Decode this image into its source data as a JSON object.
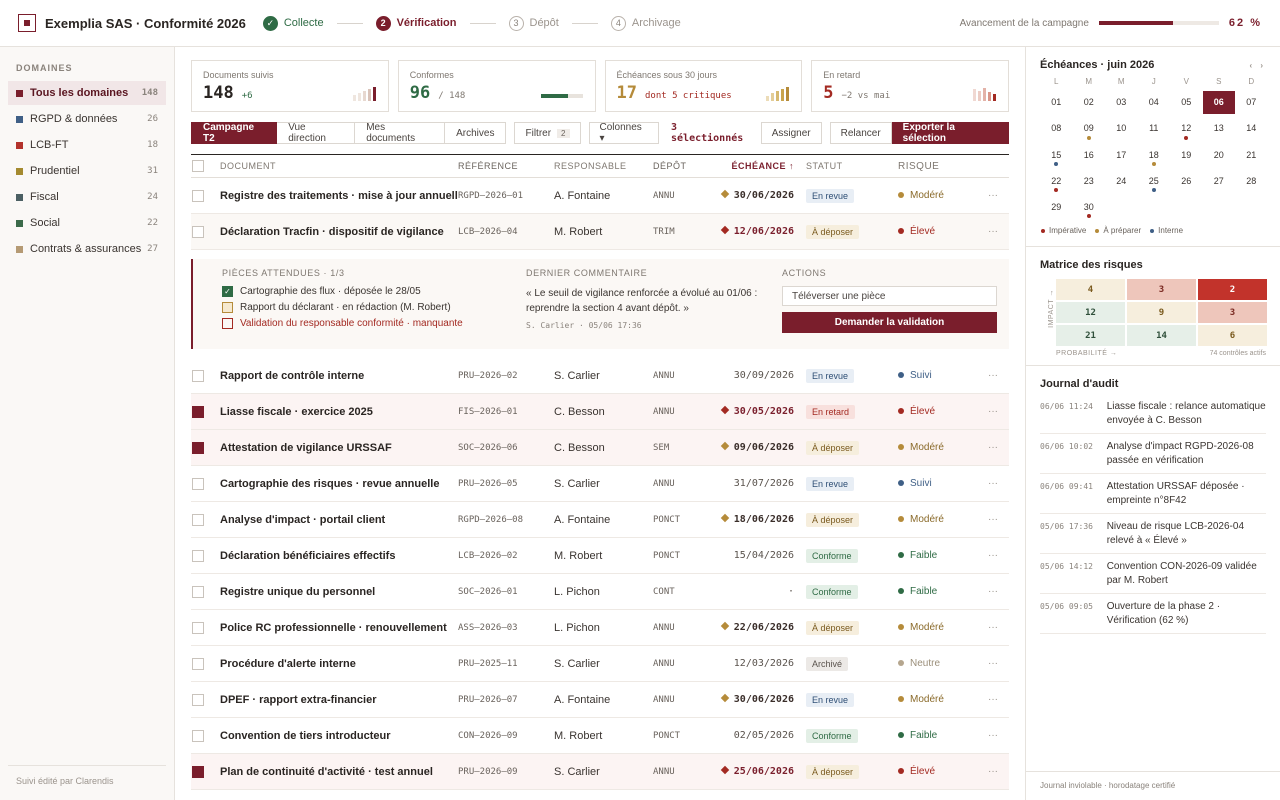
{
  "header": {
    "title": "Exemplia SAS · Conformité 2026",
    "steps": [
      {
        "num": "✓",
        "label": "Collecte",
        "state": "done"
      },
      {
        "num": "2",
        "label": "Vérification",
        "state": "active"
      },
      {
        "num": "3",
        "label": "Dépôt",
        "state": "todo"
      },
      {
        "num": "4",
        "label": "Archivage",
        "state": "todo"
      }
    ],
    "progress_label": "Avancement de la campagne",
    "progress_value": "62 %",
    "progress_fraction": 0.62
  },
  "sidebar": {
    "heading": "DOMAINES",
    "items": [
      {
        "label": "Tous les domaines",
        "count": "148",
        "color": "#7a1e2c"
      },
      {
        "label": "RGPD & données",
        "count": "26",
        "color": "#3f5f86"
      },
      {
        "label": "LCB-FT",
        "count": "18",
        "color": "#b3322c"
      },
      {
        "label": "Prudentiel",
        "count": "31",
        "color": "#a48a2f"
      },
      {
        "label": "Fiscal",
        "count": "24",
        "color": "#4b5f63"
      },
      {
        "label": "Social",
        "count": "22",
        "color": "#3b6a4a"
      },
      {
        "label": "Contrats & assurances",
        "count": "27",
        "color": "#b59a74"
      }
    ],
    "footer": "Suivi édité par Clarendis"
  },
  "kpis": [
    {
      "label": "Documents suivis",
      "value": "148",
      "sub": "+6",
      "color": "#2a2522",
      "sub_color": "#2f6b45"
    },
    {
      "label": "Conformes",
      "value": "96",
      "sub": "/ 148",
      "color": "#2f6b45",
      "sub_color": "#7f7871"
    },
    {
      "label": "Échéances sous 30 jours",
      "value": "17",
      "sub": "dont 5 critiques",
      "color": "#b58b3a",
      "sub_color": "#a32a22"
    },
    {
      "label": "En retard",
      "value": "5",
      "sub": "−2 vs mai",
      "color": "#a32a22",
      "sub_color": "#7f7871"
    }
  ],
  "toolbar": {
    "tabs": [
      "Campagne T2",
      "Vue direction",
      "Mes documents",
      "Archives"
    ],
    "filter": "Filtrer",
    "filter_badge": "2",
    "columns": "Colonnes ▾",
    "selected": "3 sélectionnés",
    "assign": "Assigner",
    "remind": "Relancer",
    "export": "Exporter la sélection"
  },
  "table": {
    "headers": {
      "doc": "DOCUMENT",
      "ref": "RÉFÉRENCE",
      "resp": "RESPONSABLE",
      "dep": "DÉPÔT",
      "ech": "ÉCHÉANCE ↑",
      "stat": "STATUT",
      "risk": "RISQUE"
    },
    "rows": [
      {
        "doc": "Registre des traitements · mise à jour annuelle",
        "ref": "RGPD–2026–01",
        "resp": "A. Fontaine",
        "dep": "ANNU",
        "ech": "30/06/2026",
        "flag": "gold",
        "stat": "En revue",
        "sk": "revue",
        "risk": "Modéré",
        "rc": "#b58b3a",
        "sel": false,
        "tint": ""
      },
      {
        "doc": "Déclaration Tracfin · dispositif de vigilance",
        "ref": "LCB–2026–04",
        "resp": "M. Robert",
        "dep": "TRIM",
        "ech": "12/06/2026",
        "flag": "red",
        "stat": "À déposer",
        "sk": "dep",
        "risk": "Élevé",
        "rc": "#a32a22",
        "sel": false,
        "tint": "soft"
      },
      {
        "doc": "Rapport de contrôle interne",
        "ref": "PRU–2026–02",
        "resp": "S. Carlier",
        "dep": "ANNU",
        "ech": "30/09/2026",
        "flag": "",
        "stat": "En revue",
        "sk": "revue",
        "risk": "Suivi",
        "rc": "#3f5f86",
        "sel": false,
        "tint": ""
      },
      {
        "doc": "Liasse fiscale · exercice 2025",
        "ref": "FIS–2026–01",
        "resp": "C. Besson",
        "dep": "ANNU",
        "ech": "30/05/2026",
        "flag": "red",
        "stat": "En retard",
        "sk": "ret",
        "risk": "Élevé",
        "rc": "#a32a22",
        "sel": true,
        "tint": "tinted"
      },
      {
        "doc": "Attestation de vigilance URSSAF",
        "ref": "SOC–2026–06",
        "resp": "C. Besson",
        "dep": "SEM",
        "ech": "09/06/2026",
        "flag": "gold",
        "stat": "À déposer",
        "sk": "dep",
        "risk": "Modéré",
        "rc": "#b58b3a",
        "sel": true,
        "tint": "tinted"
      },
      {
        "doc": "Cartographie des risques · revue annuelle",
        "ref": "PRU–2026–05",
        "resp": "S. Carlier",
        "dep": "ANNU",
        "ech": "31/07/2026",
        "flag": "",
        "stat": "En revue",
        "sk": "revue",
        "risk": "Suivi",
        "rc": "#3f5f86",
        "sel": false,
        "tint": ""
      },
      {
        "doc": "Analyse d'impact · portail client",
        "ref": "RGPD–2026–08",
        "resp": "A. Fontaine",
        "dep": "PONCT",
        "ech": "18/06/2026",
        "flag": "gold",
        "stat": "À déposer",
        "sk": "dep",
        "risk": "Modéré",
        "rc": "#b58b3a",
        "sel": false,
        "tint": ""
      },
      {
        "doc": "Déclaration bénéficiaires effectifs",
        "ref": "LCB–2026–02",
        "resp": "M. Robert",
        "dep": "PONCT",
        "ech": "15/04/2026",
        "flag": "",
        "stat": "Conforme",
        "sk": "conf",
        "risk": "Faible",
        "rc": "#2f6b45",
        "sel": false,
        "tint": ""
      },
      {
        "doc": "Registre unique du personnel",
        "ref": "SOC–2026–01",
        "resp": "L. Pichon",
        "dep": "CONT",
        "ech": "·",
        "flag": "",
        "stat": "Conforme",
        "sk": "conf",
        "risk": "Faible",
        "rc": "#2f6b45",
        "sel": false,
        "tint": ""
      },
      {
        "doc": "Police RC professionnelle · renouvellement",
        "ref": "ASS–2026–03",
        "resp": "L. Pichon",
        "dep": "ANNU",
        "ech": "22/06/2026",
        "flag": "gold",
        "stat": "À déposer",
        "sk": "dep",
        "risk": "Modéré",
        "rc": "#b58b3a",
        "sel": false,
        "tint": ""
      },
      {
        "doc": "Procédure d'alerte interne",
        "ref": "PRU–2025–11",
        "resp": "S. Carlier",
        "dep": "ANNU",
        "ech": "12/03/2026",
        "flag": "",
        "stat": "Archivé",
        "sk": "arch",
        "risk": "Neutre",
        "rc": "#b5a68e",
        "sel": false,
        "tint": ""
      },
      {
        "doc": "DPEF · rapport extra-financier",
        "ref": "PRU–2026–07",
        "resp": "A. Fontaine",
        "dep": "ANNU",
        "ech": "30/06/2026",
        "flag": "gold",
        "stat": "En revue",
        "sk": "revue",
        "risk": "Modéré",
        "rc": "#b58b3a",
        "sel": false,
        "tint": ""
      },
      {
        "doc": "Convention de tiers introducteur",
        "ref": "CON–2026–09",
        "resp": "M. Robert",
        "dep": "PONCT",
        "ech": "02/05/2026",
        "flag": "",
        "stat": "Conforme",
        "sk": "conf",
        "risk": "Faible",
        "rc": "#2f6b45",
        "sel": false,
        "tint": ""
      },
      {
        "doc": "Plan de continuité d'activité · test annuel",
        "ref": "PRU–2026–09",
        "resp": "S. Carlier",
        "dep": "ANNU",
        "ech": "25/06/2026",
        "flag": "red",
        "stat": "À déposer",
        "sk": "dep",
        "risk": "Élevé",
        "rc": "#a32a22",
        "sel": true,
        "tint": "tinted"
      }
    ]
  },
  "detail": {
    "pieces_title": "PIÈCES ATTENDUES · 1/3",
    "pieces": [
      {
        "label": "Cartographie des flux · déposée le 28/05",
        "state": "ok"
      },
      {
        "label": "Rapport du déclarant · en rédaction (M. Robert)",
        "state": "mid"
      },
      {
        "label": "Validation du responsable conformité · manquante",
        "state": "miss"
      }
    ],
    "comment_title": "DERNIER COMMENTAIRE",
    "comment": "« Le seuil de vigilance renforcée a évolué au 01/06 : reprendre la section 4 avant dépôt. »",
    "comment_sig": "S. Carlier · 05/06 17:36",
    "actions_title": "ACTIONS",
    "upload": "Téléverser une pièce",
    "request": "Demander la validation"
  },
  "calendar": {
    "title": "Échéances · juin 2026",
    "nav": "‹ ›",
    "days": [
      "L",
      "M",
      "M",
      "J",
      "V",
      "S",
      "D"
    ],
    "dates": [
      {
        "d": "01",
        "m": ""
      },
      {
        "d": "02",
        "m": ""
      },
      {
        "d": "03",
        "m": ""
      },
      {
        "d": "04",
        "m": ""
      },
      {
        "d": "05",
        "m": ""
      },
      {
        "d": "06",
        "m": "today"
      },
      {
        "d": "07",
        "m": ""
      },
      {
        "d": "08",
        "m": ""
      },
      {
        "d": "09",
        "m": "gold"
      },
      {
        "d": "10",
        "m": ""
      },
      {
        "d": "11",
        "m": ""
      },
      {
        "d": "12",
        "m": "red"
      },
      {
        "d": "13",
        "m": ""
      },
      {
        "d": "14",
        "m": ""
      },
      {
        "d": "15",
        "m": "blue"
      },
      {
        "d": "16",
        "m": ""
      },
      {
        "d": "17",
        "m": ""
      },
      {
        "d": "18",
        "m": "gold"
      },
      {
        "d": "19",
        "m": ""
      },
      {
        "d": "20",
        "m": ""
      },
      {
        "d": "21",
        "m": ""
      },
      {
        "d": "22",
        "m": "red"
      },
      {
        "d": "23",
        "m": ""
      },
      {
        "d": "24",
        "m": ""
      },
      {
        "d": "25",
        "m": "blue"
      },
      {
        "d": "26",
        "m": ""
      },
      {
        "d": "27",
        "m": ""
      },
      {
        "d": "28",
        "m": ""
      },
      {
        "d": "29",
        "m": ""
      },
      {
        "d": "30",
        "m": "red"
      }
    ],
    "legend": [
      {
        "label": "Impérative",
        "color": "#a32a22"
      },
      {
        "label": "À préparer",
        "color": "#b58b3a"
      },
      {
        "label": "Interne",
        "color": "#3f5f86"
      }
    ]
  },
  "matrix": {
    "title": "Matrice des risques",
    "ylabel": "IMPACT →",
    "xlabel": "PROBABILITÉ →",
    "note": "74 contrôles actifs",
    "cells": [
      {
        "v": "4",
        "bg": "#f6eedd",
        "c": "#7a5a1e"
      },
      {
        "v": "3",
        "bg": "#eec6bb",
        "c": "#7a2a22"
      },
      {
        "v": "2",
        "bg": "#c2332b",
        "c": "#ffffff"
      },
      {
        "v": "12",
        "bg": "#e6efe8",
        "c": "#2f4f3a"
      },
      {
        "v": "9",
        "bg": "#f6eedd",
        "c": "#7a5a1e"
      },
      {
        "v": "3",
        "bg": "#eec6bb",
        "c": "#7a2a22"
      },
      {
        "v": "21",
        "bg": "#e6efe8",
        "c": "#2f4f3a"
      },
      {
        "v": "14",
        "bg": "#e6efe8",
        "c": "#2f4f3a"
      },
      {
        "v": "6",
        "bg": "#f6eedd",
        "c": "#7a5a1e"
      }
    ]
  },
  "audit": {
    "title": "Journal d'audit",
    "entries": [
      {
        "t": "06/06 11:24",
        "x": "Liasse fiscale : relance automatique envoyée à C. Besson"
      },
      {
        "t": "06/06 10:02",
        "x": "Analyse d'impact RGPD-2026-08 passée en vérification"
      },
      {
        "t": "06/06 09:41",
        "x": "Attestation URSSAF déposée · empreinte n°8F42"
      },
      {
        "t": "05/06 17:36",
        "x": "Niveau de risque LCB-2026-04 relevé à « Élevé »"
      },
      {
        "t": "05/06 14:12",
        "x": "Convention CON-2026-09 validée par M. Robert"
      },
      {
        "t": "05/06 09:05",
        "x": "Ouverture de la phase 2 · Vérification (62 %)"
      }
    ],
    "footer": "Journal inviolable · horodatage certifié"
  }
}
